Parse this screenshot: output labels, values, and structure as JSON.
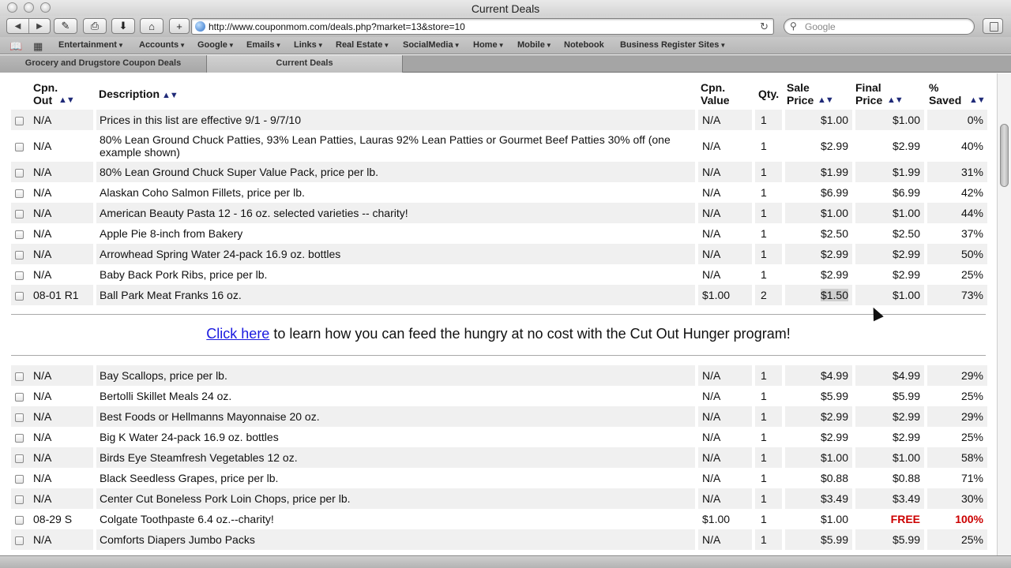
{
  "window": {
    "title": "Current Deals"
  },
  "toolbar": {
    "url": "http://www.couponmom.com/deals.php?market=13&store=10",
    "search_placeholder": "Google"
  },
  "bookmarks": [
    {
      "label": "Entertainment",
      "menu": true
    },
    {
      "label": "Accounts",
      "menu": true
    },
    {
      "label": "Google",
      "menu": true
    },
    {
      "label": "Emails",
      "menu": true
    },
    {
      "label": "Links",
      "menu": true
    },
    {
      "label": "Real Estate",
      "menu": true
    },
    {
      "label": "SocialMedia",
      "menu": true
    },
    {
      "label": "Home",
      "menu": true
    },
    {
      "label": "Mobile",
      "menu": true
    },
    {
      "label": "Notebook",
      "menu": false
    },
    {
      "label": "Business Register Sites",
      "menu": true
    }
  ],
  "tabs": [
    {
      "label": "Grocery and Drugstore Coupon Deals",
      "active": false
    },
    {
      "label": "Current Deals",
      "active": true
    }
  ],
  "table": {
    "headers": {
      "cpn_out": "Cpn. Out",
      "description": "Description",
      "cpn_value": "Cpn. Value",
      "qty": "Qty.",
      "sale_price": "Sale Price",
      "final_price": "Final Price",
      "saved": "% Saved"
    },
    "rows_top": [
      {
        "cpn": "N/A",
        "desc": "Prices in this list are effective 9/1 - 9/7/10",
        "cval": "N/A",
        "qty": "1",
        "sale": "$1.00",
        "final": "$1.00",
        "saved": "0%"
      },
      {
        "cpn": "N/A",
        "desc": "80% Lean Ground Chuck Patties, 93% Lean Patties, Lauras 92% Lean Patties or Gourmet Beef Patties 30% off (one example shown)",
        "cval": "N/A",
        "qty": "1",
        "sale": "$2.99",
        "final": "$2.99",
        "saved": "40%"
      },
      {
        "cpn": "N/A",
        "desc": "80% Lean Ground Chuck Super Value Pack, price per lb.",
        "cval": "N/A",
        "qty": "1",
        "sale": "$1.99",
        "final": "$1.99",
        "saved": "31%"
      },
      {
        "cpn": "N/A",
        "desc": "Alaskan Coho Salmon Fillets, price per lb.",
        "cval": "N/A",
        "qty": "1",
        "sale": "$6.99",
        "final": "$6.99",
        "saved": "42%"
      },
      {
        "cpn": "N/A",
        "desc": "American Beauty Pasta 12 - 16 oz. selected varieties -- charity!",
        "cval": "N/A",
        "qty": "1",
        "sale": "$1.00",
        "final": "$1.00",
        "saved": "44%"
      },
      {
        "cpn": "N/A",
        "desc": "Apple Pie 8-inch from Bakery",
        "cval": "N/A",
        "qty": "1",
        "sale": "$2.50",
        "final": "$2.50",
        "saved": "37%"
      },
      {
        "cpn": "N/A",
        "desc": "Arrowhead Spring Water 24-pack 16.9 oz. bottles",
        "cval": "N/A",
        "qty": "1",
        "sale": "$2.99",
        "final": "$2.99",
        "saved": "50%"
      },
      {
        "cpn": "N/A",
        "desc": "Baby Back Pork Ribs, price per lb.",
        "cval": "N/A",
        "qty": "1",
        "sale": "$2.99",
        "final": "$2.99",
        "saved": "25%"
      },
      {
        "cpn": "08-01 R1",
        "desc": "Ball Park Meat Franks 16 oz.",
        "cval": "$1.00",
        "qty": "2",
        "sale": "$1.50",
        "final": "$1.00",
        "saved": "73%"
      }
    ],
    "promo": {
      "link_text": "Click here",
      "text": " to learn how you can feed the hungry at no cost with the Cut Out Hunger program!"
    },
    "rows_bottom": [
      {
        "cpn": "N/A",
        "desc": "Bay Scallops, price per lb.",
        "cval": "N/A",
        "qty": "1",
        "sale": "$4.99",
        "final": "$4.99",
        "saved": "29%"
      },
      {
        "cpn": "N/A",
        "desc": "Bertolli Skillet Meals 24 oz.",
        "cval": "N/A",
        "qty": "1",
        "sale": "$5.99",
        "final": "$5.99",
        "saved": "25%"
      },
      {
        "cpn": "N/A",
        "desc": "Best Foods or Hellmanns Mayonnaise 20 oz.",
        "cval": "N/A",
        "qty": "1",
        "sale": "$2.99",
        "final": "$2.99",
        "saved": "29%"
      },
      {
        "cpn": "N/A",
        "desc": "Big K Water 24-pack 16.9 oz. bottles",
        "cval": "N/A",
        "qty": "1",
        "sale": "$2.99",
        "final": "$2.99",
        "saved": "25%"
      },
      {
        "cpn": "N/A",
        "desc": "Birds Eye Steamfresh Vegetables 12 oz.",
        "cval": "N/A",
        "qty": "1",
        "sale": "$1.00",
        "final": "$1.00",
        "saved": "58%"
      },
      {
        "cpn": "N/A",
        "desc": "Black Seedless Grapes, price per lb.",
        "cval": "N/A",
        "qty": "1",
        "sale": "$0.88",
        "final": "$0.88",
        "saved": "71%"
      },
      {
        "cpn": "N/A",
        "desc": "Center Cut Boneless Pork Loin Chops, price per lb.",
        "cval": "N/A",
        "qty": "1",
        "sale": "$3.49",
        "final": "$3.49",
        "saved": "30%"
      },
      {
        "cpn": "08-29 S",
        "desc": "Colgate Toothpaste 6.4 oz.--charity!",
        "cval": "$1.00",
        "qty": "1",
        "sale": "$1.00",
        "final": "FREE",
        "saved": "100%"
      },
      {
        "cpn": "N/A",
        "desc": "Comforts Diapers Jumbo Packs",
        "cval": "N/A",
        "qty": "1",
        "sale": "$5.99",
        "final": "$5.99",
        "saved": "25%"
      }
    ]
  },
  "colors": {
    "free_text": "#cc0000",
    "link": "#1a1adf",
    "sort_arrows": "#1f2a78"
  }
}
